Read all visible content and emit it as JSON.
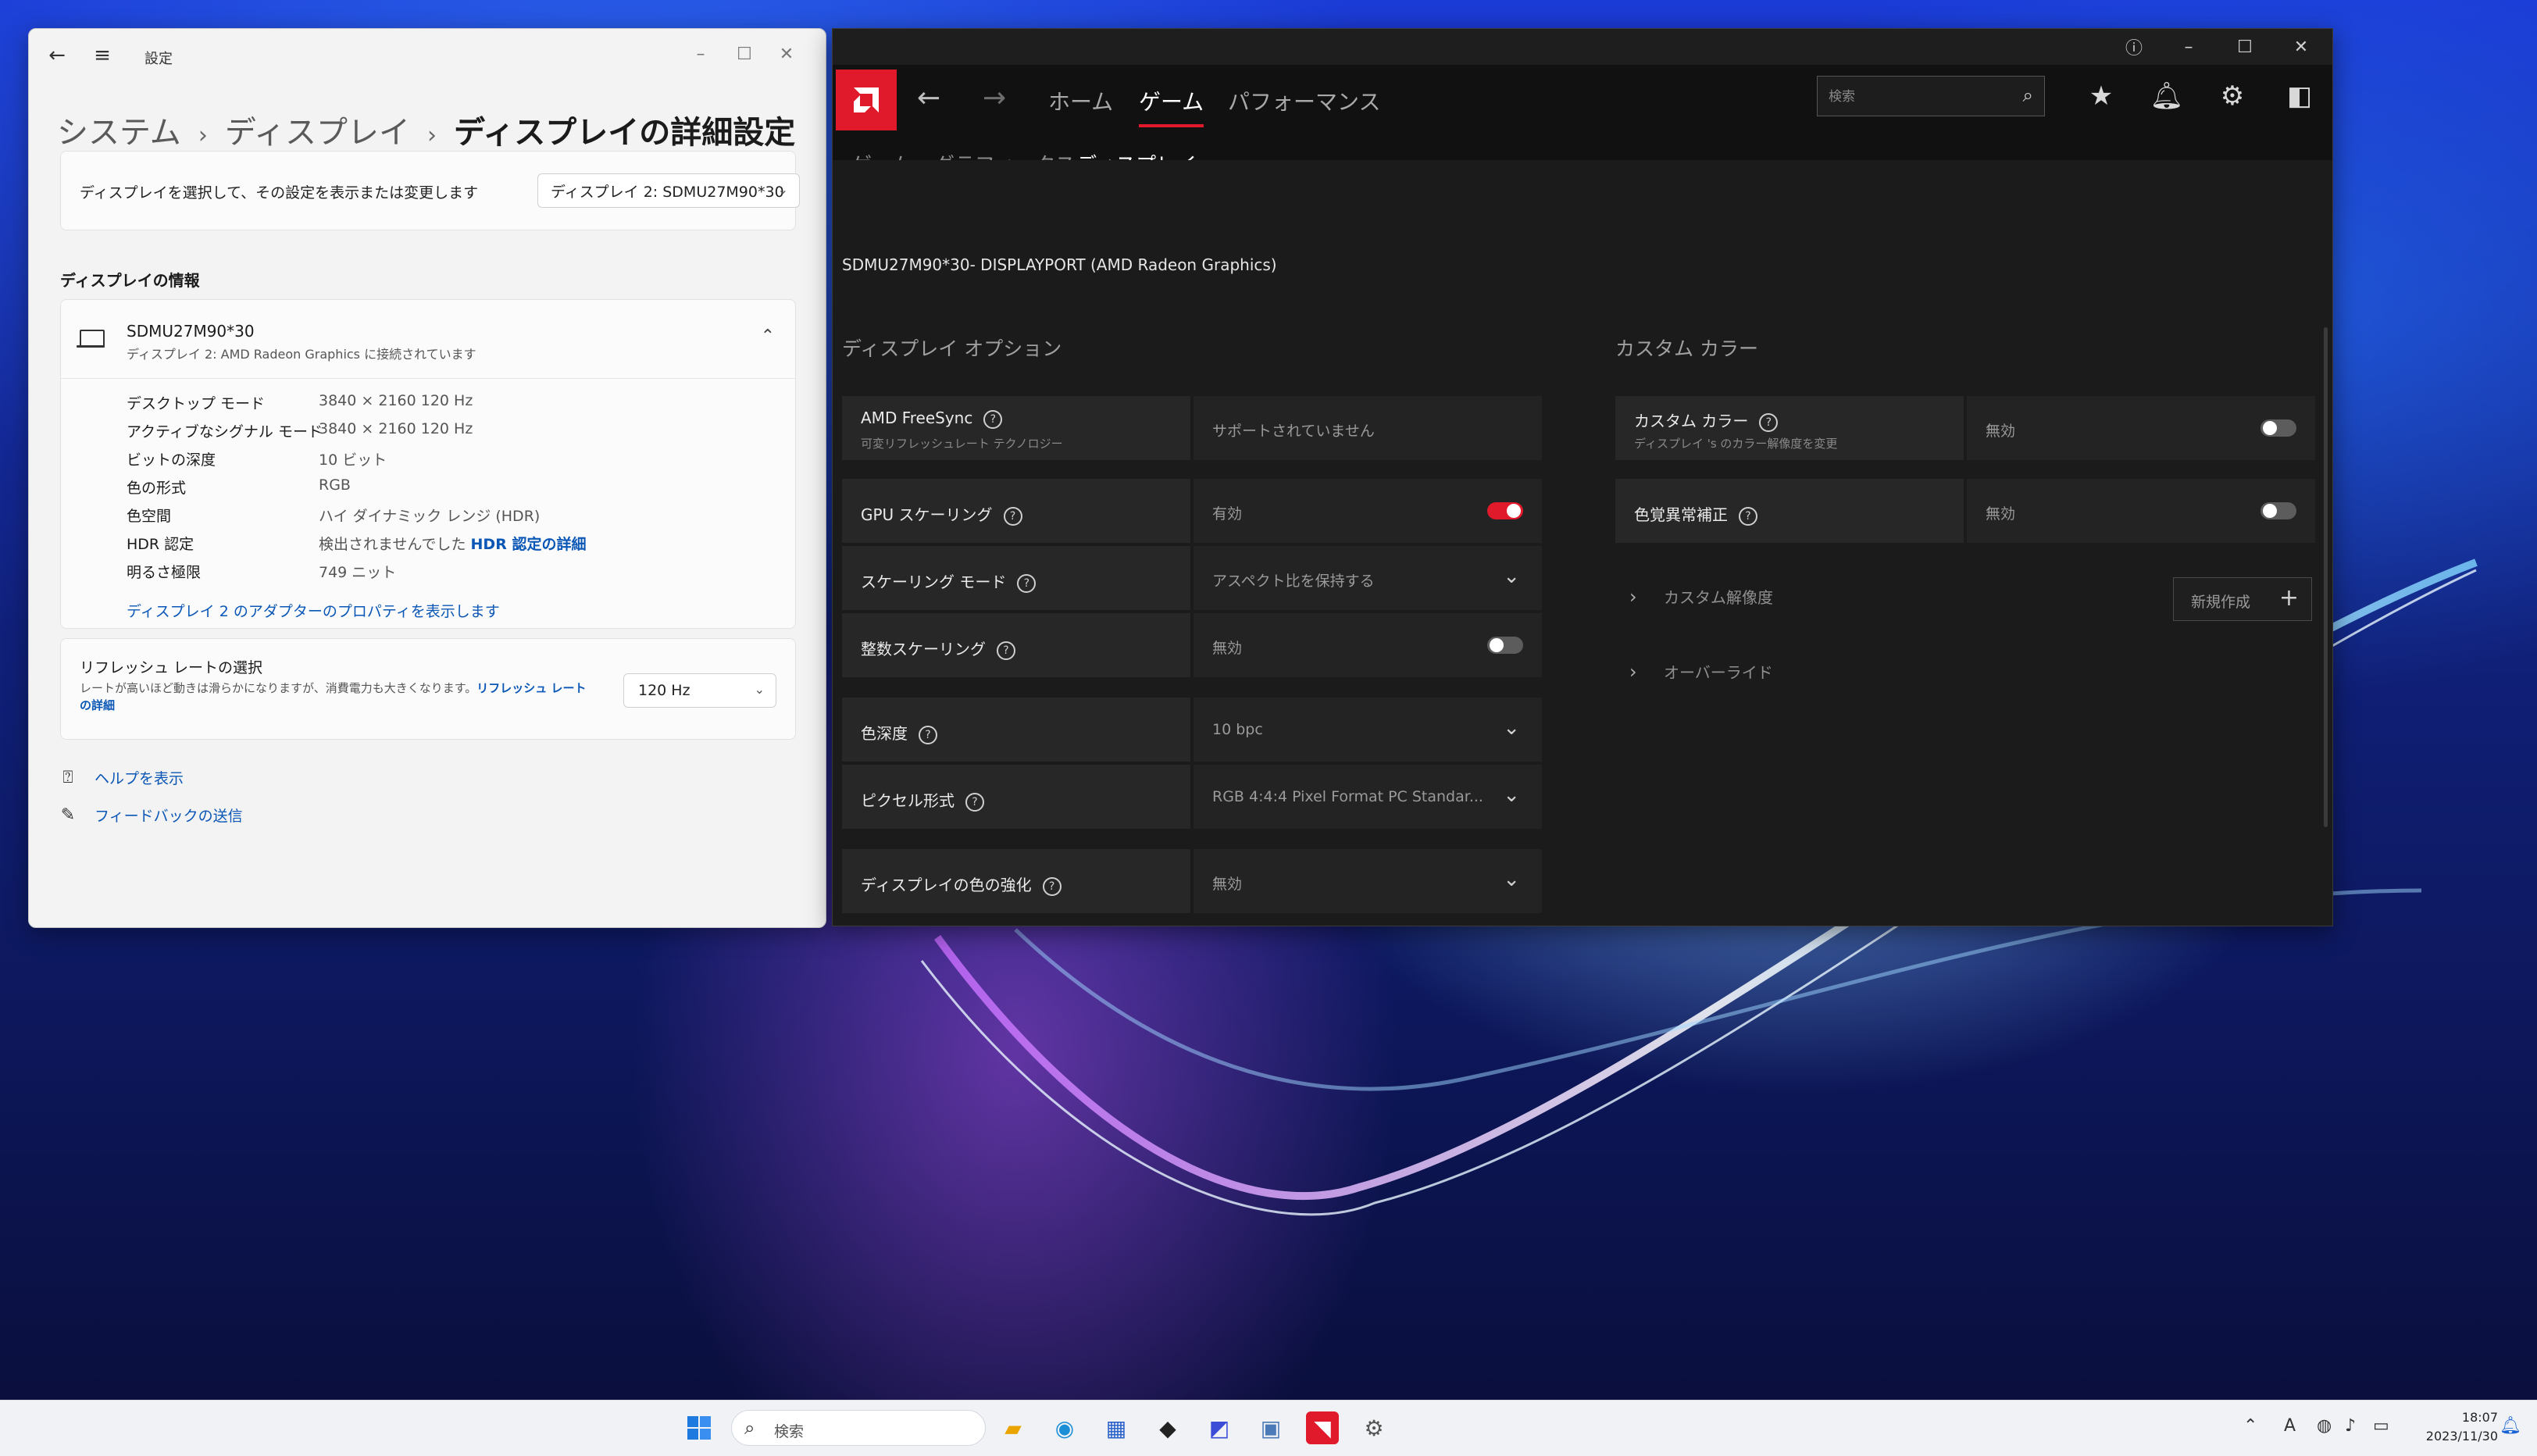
{
  "settings": {
    "window_title": "設定",
    "breadcrumb": [
      "システム",
      "ディスプレイ",
      "ディスプレイの詳細設定"
    ],
    "select_label": "ディスプレイを選択して、その設定を表示または変更します",
    "selected_display": "ディスプレイ 2: SDMU27M90*30",
    "section_title": "ディスプレイの情報",
    "display_name": "SDMU27M90*30",
    "display_sub": "ディスプレイ 2: AMD Radeon Graphics に接続されています",
    "info": [
      {
        "key": "デスクトップ モード",
        "value": "3840 × 2160 120 Hz"
      },
      {
        "key": "アクティブなシグナル モード",
        "value": "3840 × 2160 120 Hz"
      },
      {
        "key": "ビットの深度",
        "value": "10 ビット"
      },
      {
        "key": "色の形式",
        "value": "RGB"
      },
      {
        "key": "色空間",
        "value": "ハイ ダイナミック レンジ (HDR)"
      },
      {
        "key": "HDR 認定",
        "value": "検出されませんでした",
        "link": "HDR 認定の詳細"
      },
      {
        "key": "明るさ極限",
        "value": "749 ニット"
      }
    ],
    "adapter_link": "ディスプレイ 2 のアダプターのプロパティを表示します",
    "refresh_title": "リフレッシュ レートの選択",
    "refresh_desc": "レートが高いほど動きは滑らかになりますが、消費電力も大きくなります。",
    "refresh_link": "リフレッシュ レートの詳細",
    "refresh_value": "120 Hz",
    "help": "ヘルプを表示",
    "feedback": "フィードバックの送信"
  },
  "amd": {
    "nav_tabs": [
      "ホーム",
      "ゲーム",
      "パフォーマンス"
    ],
    "active_nav": "ゲーム",
    "search_placeholder": "検索",
    "sub_tabs": [
      "ゲーム",
      "グラフィックス",
      "ディスプレイ"
    ],
    "active_sub": "ディスプレイ",
    "device": "SDMU27M90*30- DISPLAYPORT (AMD Radeon Graphics)",
    "options_title": "ディスプレイ オプション",
    "custom_title": "カスタム カラー",
    "options": [
      {
        "label": "AMD FreeSync",
        "sub": "可変リフレッシュレート テクノロジー",
        "value": "サポートされていません",
        "control": "none"
      },
      {
        "label": "GPU スケーリング",
        "value": "有効",
        "control": "toggle-on"
      },
      {
        "label": "スケーリング モード",
        "value": "アスペクト比を保持する",
        "control": "dropdown"
      },
      {
        "label": "整数スケーリング",
        "value": "無効",
        "control": "toggle-off"
      },
      {
        "label": "色深度",
        "value": "10 bpc",
        "control": "dropdown"
      },
      {
        "label": "ピクセル形式",
        "value": "RGB 4:4:4 Pixel Format PC Standar...",
        "control": "dropdown"
      },
      {
        "label": "ディスプレイの色の強化",
        "value": "無効",
        "control": "dropdown"
      }
    ],
    "custom": [
      {
        "label": "カスタム カラー",
        "sub": "ディスプレイ 's のカラー解像度を変更",
        "value": "無効",
        "control": "toggle-off"
      },
      {
        "label": "色覚異常補正",
        "value": "無効",
        "control": "toggle-off"
      }
    ],
    "custom_resolution": "カスタム解像度",
    "new_button": "新規作成",
    "override": "オーバーライド",
    "accent": "#e01a2a"
  },
  "taskbar": {
    "search": "検索",
    "tray_ime": "A",
    "time": "18:07",
    "date": "2023/11/30"
  }
}
